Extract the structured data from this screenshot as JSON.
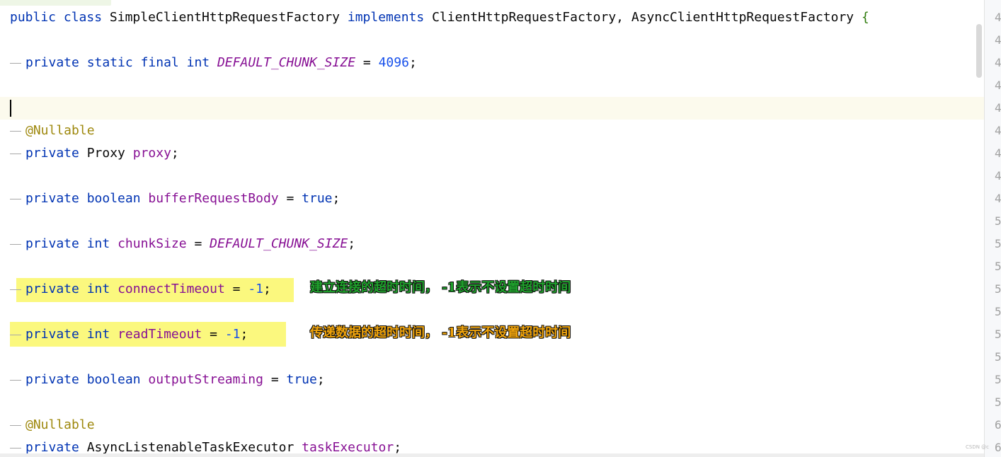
{
  "code": {
    "class_decl": {
      "kw_public": "public",
      "kw_class": "class",
      "class_name": "SimpleClientHttpRequestFactory",
      "kw_implements": "implements",
      "iface1": "ClientHttpRequestFactory,",
      "iface2": "AsyncClientHttpRequestFactory",
      "brace": "{"
    },
    "line_default_chunk": {
      "kw_private": "private",
      "kw_static": "static",
      "kw_final": "final",
      "kw_int": "int",
      "const_name": "DEFAULT_CHUNK_SIZE",
      "op": "=",
      "value": "4096",
      "end": ";"
    },
    "annotation_nullable_1": "@Nullable",
    "line_proxy": {
      "kw_private": "private",
      "type": "Proxy",
      "field": "proxy",
      "end": ";"
    },
    "line_buffer": {
      "kw_private": "private",
      "kw_boolean": "boolean",
      "field": "bufferRequestBody",
      "op": "=",
      "value": "true",
      "end": ";"
    },
    "line_chunk": {
      "kw_private": "private",
      "kw_int": "int",
      "field": "chunkSize",
      "op": "=",
      "value": "DEFAULT_CHUNK_SIZE",
      "end": ";"
    },
    "line_connect": {
      "kw_private": "private",
      "kw_int": "int",
      "field": "connectTimeout",
      "op": "=",
      "value": "-1",
      "end": ";"
    },
    "line_read": {
      "kw_private": "private",
      "kw_int": "int",
      "field": "readTimeout",
      "op": "=",
      "value": "-1",
      "end": ";"
    },
    "line_output": {
      "kw_private": "private",
      "kw_boolean": "boolean",
      "field": "outputStreaming",
      "op": "=",
      "value": "true",
      "end": ";"
    },
    "annotation_nullable_2": "@Nullable",
    "line_executor": {
      "kw_private": "private",
      "type": "AsyncListenableTaskExecutor",
      "field": "taskExecutor",
      "end": ";"
    }
  },
  "annotations": {
    "connect_note": "建立连接的超时时间， -1表示不设置超时时间",
    "read_note": "传递数据的超时时间， -1表示不设置超时时间"
  },
  "gutter_numbers": [
    "4",
    "4",
    "4",
    "4",
    "4",
    "4",
    "4",
    "4",
    "4",
    "5",
    "5",
    "5",
    "5",
    "5",
    "5",
    "5",
    "5",
    "5",
    "6",
    "6"
  ],
  "watermark": "CSDN @c",
  "colors": {
    "keyword": "#0033b3",
    "field": "#871094",
    "annotation": "#9e880d",
    "number": "#1750eb",
    "highlight": "#fbf87e",
    "caret_line": "#fcfaed",
    "note_connect": "#1fa22c",
    "note_read": "#f2a50c"
  }
}
